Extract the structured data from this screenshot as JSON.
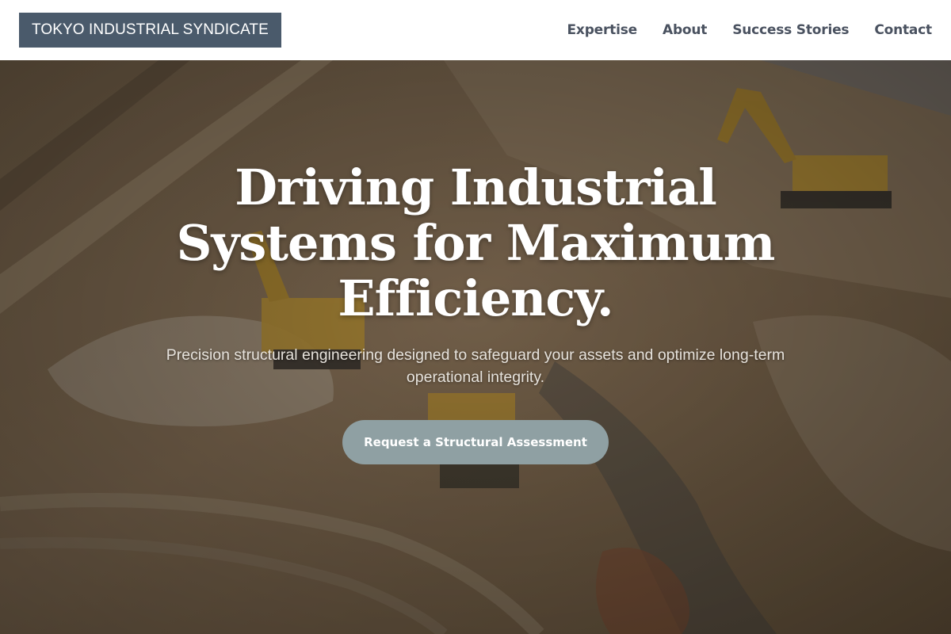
{
  "header": {
    "logo": "TOKYO INDUSTRIAL SYNDICATE",
    "nav": [
      {
        "label": "Expertise"
      },
      {
        "label": "About"
      },
      {
        "label": "Success Stories"
      },
      {
        "label": "Contact"
      }
    ]
  },
  "hero": {
    "title": "Driving Industrial Systems for Maximum Efficiency.",
    "subtitle": "Precision structural engineering designed to safeguard your assets and optimize long-term operational integrity.",
    "cta_label": "Request a Structural Assessment",
    "background": "aerial-construction-site-with-excavators"
  },
  "colors": {
    "logo_bg": "#4a5a6b",
    "nav_text": "#4a5260",
    "cta_bg": "#8fa0a3",
    "header_bg": "#ffffff"
  }
}
